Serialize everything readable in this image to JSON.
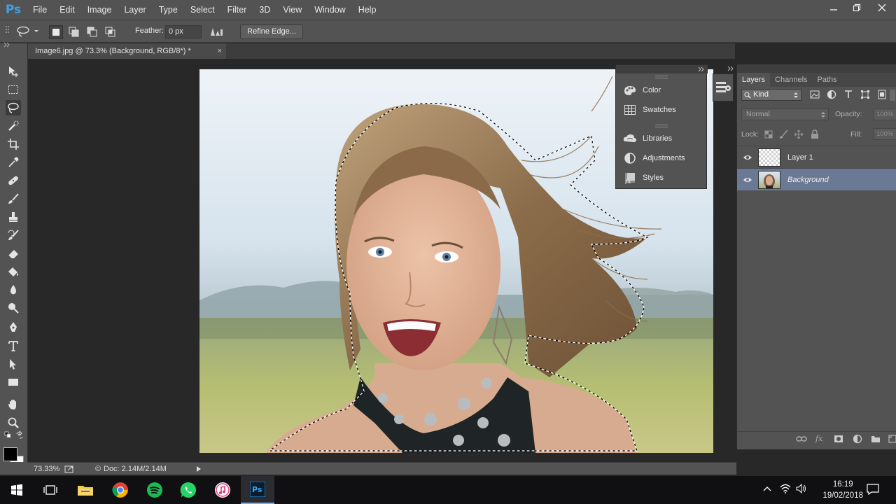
{
  "app": {
    "logo": "Ps"
  },
  "menu": [
    "File",
    "Edit",
    "Image",
    "Layer",
    "Type",
    "Select",
    "Filter",
    "3D",
    "View",
    "Window",
    "Help"
  ],
  "window_controls": {
    "minimize": "minimize-icon",
    "restore": "restore-icon",
    "close": "close-icon"
  },
  "options": {
    "feather_label": "Feather:",
    "feather_value": "0 px",
    "refine_edge": "Refine Edge..."
  },
  "document_tab": {
    "title": "Image6.jpg @ 73.3% (Background, RGB/8*) *",
    "close": "×"
  },
  "tools": [
    "move-tool-icon",
    "marquee-tool-icon",
    "lasso-tool-icon",
    "quick-selection-tool-icon",
    "crop-tool-icon",
    "eyedropper-tool-icon",
    "healing-brush-tool-icon",
    "brush-tool-icon",
    "clone-stamp-tool-icon",
    "history-brush-tool-icon",
    "eraser-tool-icon",
    "paint-bucket-tool-icon",
    "blur-tool-icon",
    "dodge-tool-icon",
    "pen-tool-icon",
    "type-tool-icon",
    "path-selection-tool-icon",
    "rectangle-tool-icon",
    "hand-tool-icon",
    "zoom-tool-icon"
  ],
  "float_panel": {
    "items": [
      "Color",
      "Swatches",
      "Libraries",
      "Adjustments",
      "Styles"
    ]
  },
  "layers_panel": {
    "tabs": [
      "Layers",
      "Channels",
      "Paths"
    ],
    "kind": "Kind",
    "blend_mode": "Normal",
    "opacity_label": "Opacity:",
    "opacity_value": "100%",
    "lock_label": "Lock:",
    "fill_label": "Fill:",
    "fill_value": "100%",
    "layers": [
      {
        "name": "Layer 1",
        "selected": false
      },
      {
        "name": "Background",
        "selected": true
      }
    ]
  },
  "status": {
    "zoom": "73.33%",
    "doc": "Doc: 2.14M/2.14M"
  },
  "taskbar": {
    "apps": [
      "windows-start-icon",
      "task-view-icon",
      "file-explorer-icon",
      "chrome-icon",
      "spotify-icon",
      "whatsapp-icon",
      "itunes-icon",
      "photoshop-icon"
    ],
    "time": "16:19",
    "date": "19/02/2018"
  },
  "colors": {
    "accent": "#3ea3e6",
    "panel": "#535353",
    "selected_layer": "#6a7a94"
  }
}
